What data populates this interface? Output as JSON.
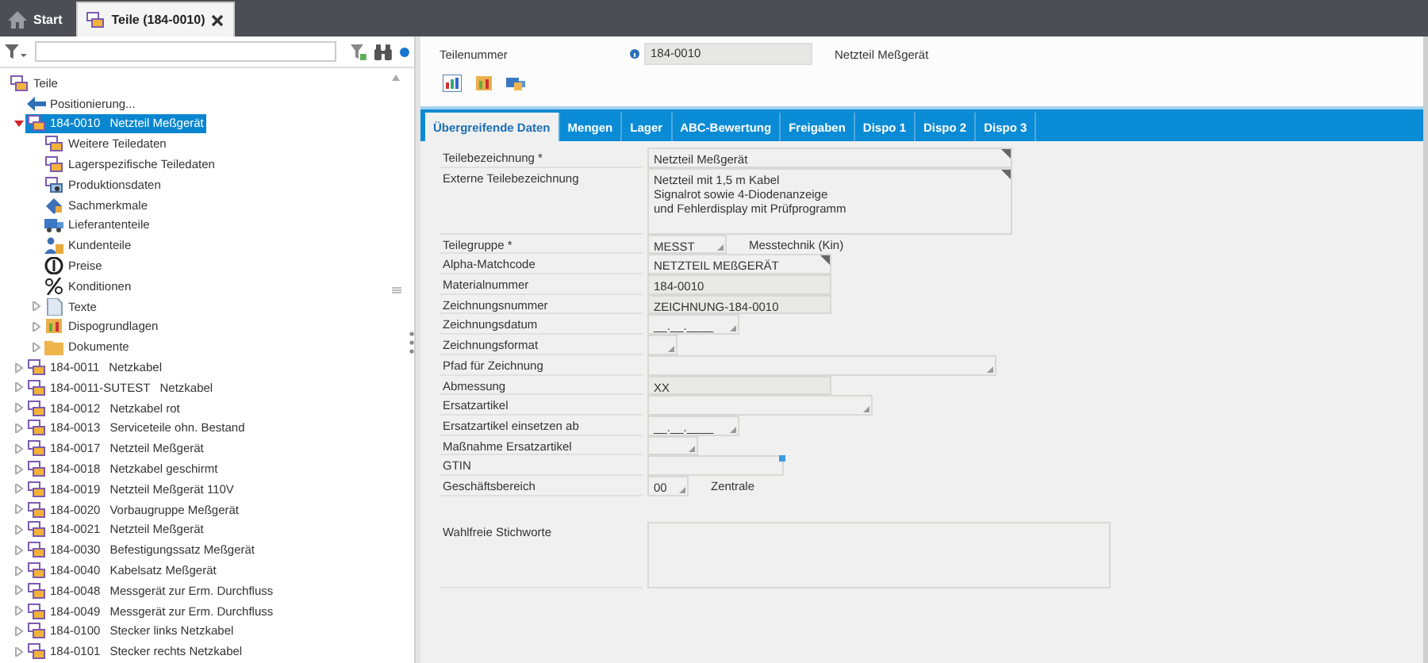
{
  "top_tabs": [
    {
      "label": "Start",
      "kind": "home",
      "selected": false,
      "closable": false
    },
    {
      "label": "Teile (184-0010)",
      "kind": "part",
      "selected": true,
      "closable": true
    }
  ],
  "tree": [
    {
      "label": "Teile",
      "kind": "part",
      "selected": false,
      "children": [
        {
          "label": "Positionierung...",
          "kind": "back",
          "selected": false
        },
        {
          "number": "184-0010",
          "label": "Netzteil Meßgerät",
          "kind": "part",
          "selected": true,
          "expanded": true,
          "children": [
            {
              "label": "Weitere Teiledaten",
              "kind": "part",
              "selected": false
            },
            {
              "label": "Lagerspezifische Teiledaten",
              "kind": "part",
              "selected": false
            },
            {
              "label": "Produktionsdaten",
              "kind": "production",
              "selected": false
            },
            {
              "label": "Sachmerkmale",
              "kind": "feature",
              "selected": false
            },
            {
              "label": "Lieferantenteile",
              "kind": "supplier",
              "selected": false
            },
            {
              "label": "Kundenteile",
              "kind": "customer",
              "selected": false
            },
            {
              "label": "Preise",
              "kind": "price",
              "selected": false
            },
            {
              "label": "Konditionen",
              "kind": "percent",
              "selected": false
            },
            {
              "label": "Texte",
              "kind": "text",
              "selected": false,
              "expanded": false
            },
            {
              "label": "Dispogrundlagen",
              "kind": "planning",
              "selected": false,
              "expanded": false
            },
            {
              "label": "Dokumente",
              "kind": "folder",
              "selected": false,
              "expanded": false
            }
          ]
        },
        {
          "number": "184-0011",
          "label": "Netzkabel",
          "kind": "part",
          "selected": false,
          "expanded": false
        },
        {
          "number": "184-0011-SUTEST",
          "label": "Netzkabel",
          "kind": "part",
          "selected": false,
          "expanded": false
        },
        {
          "number": "184-0012",
          "label": "Netzkabel rot",
          "kind": "part",
          "selected": false,
          "expanded": false
        },
        {
          "number": "184-0013",
          "label": "Serviceteile ohn. Bestand",
          "kind": "part",
          "selected": false,
          "expanded": false
        },
        {
          "number": "184-0017",
          "label": "Netzteil Meßgerät",
          "kind": "part",
          "selected": false,
          "expanded": false
        },
        {
          "number": "184-0018",
          "label": "Netzkabel geschirmt",
          "kind": "part",
          "selected": false,
          "expanded": false
        },
        {
          "number": "184-0019",
          "label": "Netzteil Meßgerät 110V",
          "kind": "part",
          "selected": false,
          "expanded": false
        },
        {
          "number": "184-0020",
          "label": "Vorbaugruppe Meßgerät",
          "kind": "part",
          "selected": false,
          "expanded": false
        },
        {
          "number": "184-0021",
          "label": "Netzteil Meßgerät",
          "kind": "part",
          "selected": false,
          "expanded": false
        },
        {
          "number": "184-0030",
          "label": "Befestigungssatz Meßgerät",
          "kind": "part",
          "selected": false,
          "expanded": false
        },
        {
          "number": "184-0040",
          "label": "Kabelsatz Meßgerät",
          "kind": "part",
          "selected": false,
          "expanded": false
        },
        {
          "number": "184-0048",
          "label": "Messgerät zur Erm. Durchfluss",
          "kind": "part",
          "selected": false,
          "expanded": false
        },
        {
          "number": "184-0049",
          "label": "Messgerät zur Erm. Durchfluss",
          "kind": "part",
          "selected": false,
          "expanded": false
        },
        {
          "number": "184-0100",
          "label": "Stecker links Netzkabel",
          "kind": "part",
          "selected": false,
          "expanded": false
        },
        {
          "number": "184-0101",
          "label": "Stecker rechts Netzkabel",
          "kind": "part",
          "selected": false,
          "expanded": false
        }
      ]
    }
  ],
  "header": {
    "label": "Teilenummer",
    "value": "184-0010",
    "description": "Netzteil Meßgerät"
  },
  "tabs": [
    {
      "label": "Übergreifende Daten",
      "selected": true
    },
    {
      "label": "Mengen",
      "selected": false
    },
    {
      "label": "Lager",
      "selected": false
    },
    {
      "label": "ABC-Bewertung",
      "selected": false
    },
    {
      "label": "Freigaben",
      "selected": false
    },
    {
      "label": "Dispo 1",
      "selected": false
    },
    {
      "label": "Dispo 2",
      "selected": false
    },
    {
      "label": "Dispo 3",
      "selected": false
    }
  ],
  "fields": [
    {
      "label": "Teilebezeichnung *",
      "kind": "memo",
      "value": "Netzteil Meßgerät"
    },
    {
      "label": "Externe Teilebezeichnung",
      "kind": "memo-area",
      "value": "Netzteil mit 1,5 m Kabel\nSignalrot sowie 4-Diodenanzeige\nund Fehlerdisplay mit Prüfprogramm"
    },
    {
      "label": "Teilegruppe *",
      "kind": "combo",
      "value": "MESST",
      "note": "Messtechnik (Kin)"
    },
    {
      "label": "Alpha-Matchcode",
      "kind": "memo",
      "value": "NETZTEIL MEßGERÄT"
    },
    {
      "label": "Materialnummer",
      "kind": "text",
      "value": "184-0010"
    },
    {
      "label": "Zeichnungsnummer",
      "kind": "text",
      "value": "ZEICHNUNG-184-0010"
    },
    {
      "label": "Zeichnungsdatum",
      "kind": "combo",
      "value": "__.__.____"
    },
    {
      "label": "Zeichnungsformat",
      "kind": "combo"
    },
    {
      "label": "Pfad für Zeichnung",
      "kind": "combo"
    },
    {
      "label": "Abmessung",
      "kind": "text",
      "value": "XX"
    },
    {
      "label": "Ersatzartikel",
      "kind": "combo"
    },
    {
      "label": "Ersatzartikel einsetzen ab",
      "kind": "combo",
      "value": "__.__.____"
    },
    {
      "label": "Maßnahme Ersatzartikel",
      "kind": "combo"
    },
    {
      "label": "GTIN",
      "kind": "checked-text"
    },
    {
      "label": "Geschäftsbereich",
      "kind": "combo",
      "value": "00",
      "note": "Zentrale"
    },
    {
      "label": "Wahlfreie Stichworte",
      "kind": "area"
    }
  ]
}
